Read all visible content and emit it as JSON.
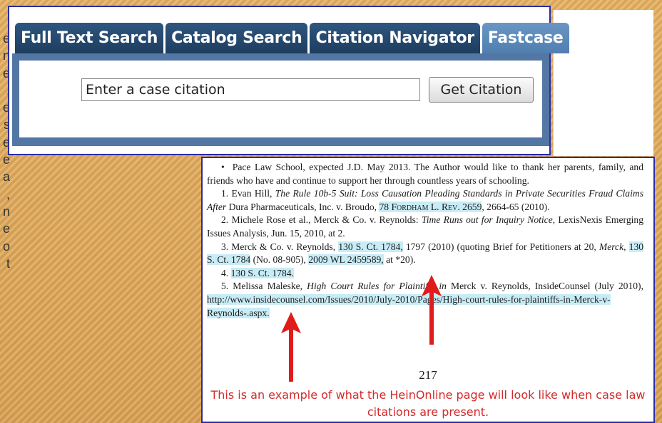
{
  "left_fragments": [
    "e",
    "n",
    "e",
    ".",
    "e",
    "s",
    "e",
    "e",
    "a",
    ",",
    "n",
    "e",
    "o",
    "t"
  ],
  "search": {
    "tabs": [
      {
        "label": "Full Text Search",
        "active": false
      },
      {
        "label": "Catalog Search",
        "active": false
      },
      {
        "label": "Citation Navigator",
        "active": false
      },
      {
        "label": "Fastcase",
        "active": true
      }
    ],
    "input_value": "Enter a case citation",
    "button_label": "Get Citation"
  },
  "document": {
    "footnote_star": "Pace Law School, expected J.D. May 2013. The Author would like to thank her parents, family, and friends who have and continue to support her through countless years of schooling.",
    "fn1": {
      "prefix": "1. Evan Hill, ",
      "title": "The Rule 10b-5 Suit: Loss Causation Pleading Standards in Private Securities Fraud Claims After",
      "mid": " Dura Pharmaceuticals, Inc. v. Broudo, ",
      "cite": "78 Fordham L. Rev. 2659",
      "suffix": ", 2664-65 (2010)."
    },
    "fn2": {
      "prefix": "2. Michele Rose et al., Merck & Co. v. Reynolds: ",
      "title": "Time Runs out for Inquiry Notice",
      "suffix": ", LexisNexis Emerging Issues Analysis, Jun. 15, 2010, at 2."
    },
    "fn3": {
      "prefix": "3. Merck & Co. v. Reynolds, ",
      "cite1": "130 S. Ct. 1784,",
      "mid1": " 1797 (2010) (quoting Brief for Petitioners at 20, ",
      "case": "Merck",
      "mid2": ", ",
      "cite2": "130 S. Ct. 1784",
      "mid3": " (No. 08-905), ",
      "cite3": "2009 WL 2459589,",
      "suffix": " at *20)."
    },
    "fn4": {
      "prefix": "4. ",
      "cite": "130 S. Ct. 1784."
    },
    "fn5": {
      "prefix": "5. Melissa Maleske, ",
      "title": "High Court Rules for Plaintiffs in",
      "mid": " Merck v. Reynolds, InsideCounsel (July 2010), ",
      "url": "http://www.insidecounsel.com/Issues/2010/July-2010/Pages/High-court-rules-for-plaintiffs-in-Merck-v-Reynolds-.aspx."
    },
    "page_number": "217",
    "caption": "This is an example of what the HeinOnline page will look like when case law citations are present."
  },
  "colors": {
    "tab": "#1e3d5f",
    "tab_active": "#5b8bbd",
    "panel": "#5377a4",
    "highlight": "#c8ecf6",
    "caption": "#d42a2a",
    "arrow": "#e01b1b",
    "frame": "#2a2ca8"
  }
}
